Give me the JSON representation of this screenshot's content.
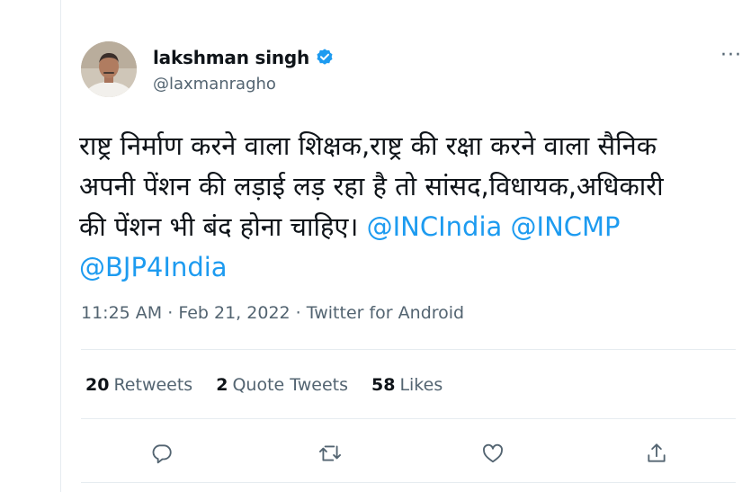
{
  "author": {
    "display_name": "lakshman singh",
    "handle": "@laxmanragho"
  },
  "tweet": {
    "text_line1": "राष्ट्र निर्माण करने वाला शिक्षक,राष्ट्र की रक्षा करने वाला सैनिक",
    "text_line2": "अपनी पेंशन की लड़ाई लड़ रहा है तो सांसद,विधायक,अधिकारी",
    "text_line3": "की पेंशन भी बंद होना चाहिए।",
    "mentions": [
      "@INCIndia",
      "@INCMP",
      "@BJP4India"
    ]
  },
  "meta": {
    "time": "11:25 AM",
    "separator": "·",
    "date": "Feb 21, 2022",
    "source": "Twitter for Android"
  },
  "stats": [
    {
      "count": "20",
      "label": "Retweets"
    },
    {
      "count": "2",
      "label": "Quote Tweets"
    },
    {
      "count": "58",
      "label": "Likes"
    }
  ],
  "icons": {
    "more": "more-icon",
    "verified": "verified-badge-icon",
    "reply": "reply-icon",
    "retweet": "retweet-icon",
    "like": "like-icon",
    "share": "share-icon"
  },
  "colors": {
    "text": "#0f1419",
    "secondary": "#536471",
    "accent": "#1d9bf0",
    "divider": "#e6ecf0"
  }
}
